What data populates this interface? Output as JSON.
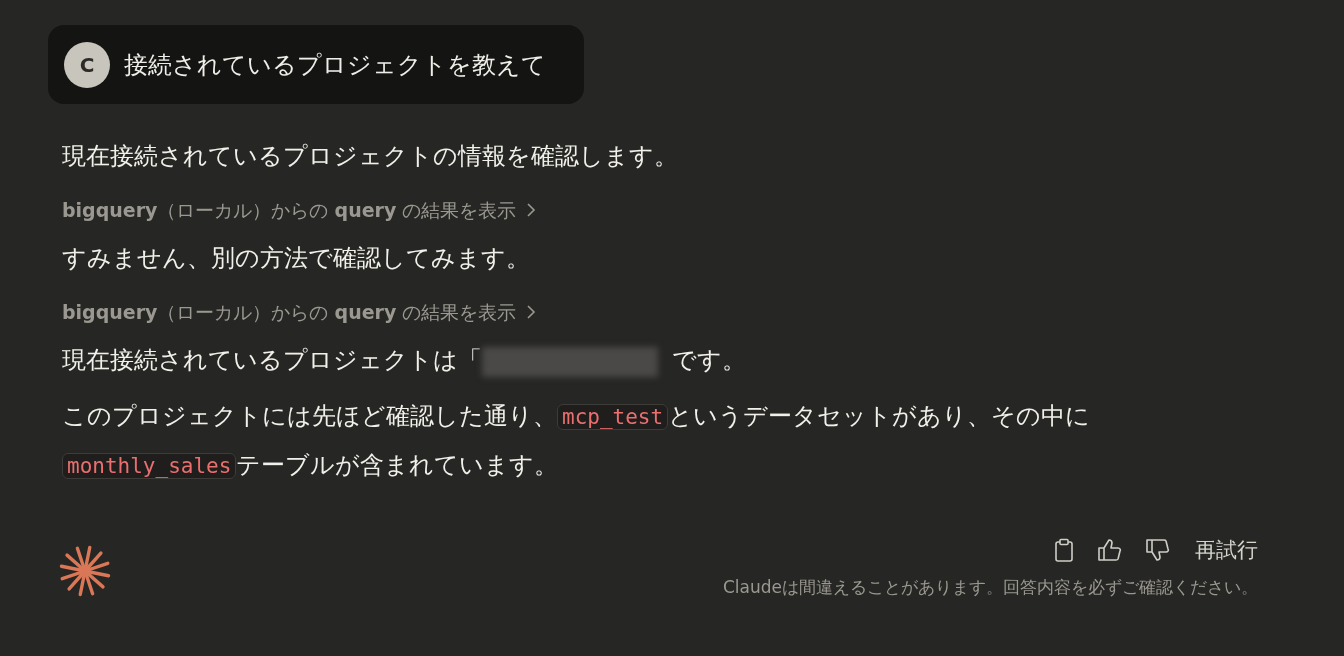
{
  "user_message": {
    "avatar": "C",
    "text": "接続されているプロジェクトを教えて"
  },
  "response": [
    {
      "kind": "text",
      "segments": [
        {
          "kind": "text",
          "text": "現在接続されているプロジェクトの情報を確認します。"
        }
      ]
    },
    {
      "kind": "tool",
      "text": "**bigquery**（ローカル）からの **query** の結果を表示"
    },
    {
      "kind": "text",
      "segments": [
        {
          "kind": "text",
          "text": "すみません、別の方法で確認してみます。"
        }
      ]
    },
    {
      "kind": "tool",
      "text": "**bigquery**（ローカル）からの **query** の結果を表示"
    },
    {
      "kind": "text",
      "segments": [
        {
          "kind": "text",
          "text": "現在接続されているプロジェクトは「"
        },
        {
          "kind": "redacted"
        },
        {
          "kind": "text",
          "text": "です。"
        }
      ]
    },
    {
      "kind": "text",
      "segments": [
        {
          "kind": "text",
          "text": "このプロジェクトには先ほど確認した通り、"
        },
        {
          "kind": "code",
          "text": "mcp_test"
        },
        {
          "kind": "text",
          "text": "というデータセットがあり、その中に"
        },
        {
          "kind": "code",
          "text": "monthly_sales"
        },
        {
          "kind": "text",
          "text": "テーブルが含まれています。"
        }
      ]
    }
  ],
  "actions": {
    "retry": "再試行"
  },
  "disclaimer": "Claudeは間違えることがあります。回答内容を必ずご確認ください。"
}
